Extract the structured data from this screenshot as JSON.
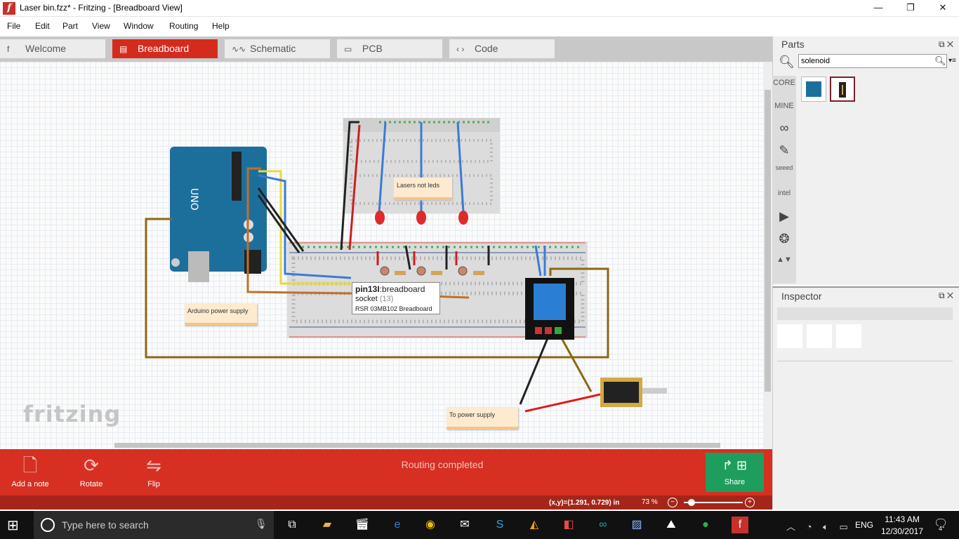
{
  "window": {
    "title": "Laser bin.fzz* - Fritzing - [Breadboard View]",
    "app_icon": "f",
    "minimize": "—",
    "maximize": "❐",
    "close": "✕"
  },
  "menubar": [
    "File",
    "Edit",
    "Part",
    "View",
    "Window",
    "Routing",
    "Help"
  ],
  "tabs": [
    {
      "label": "Welcome",
      "icon": "f",
      "active": false
    },
    {
      "label": "Breadboard",
      "icon": "▤",
      "active": true
    },
    {
      "label": "Schematic",
      "icon": "∿∿",
      "active": false
    },
    {
      "label": "PCB",
      "icon": "▭",
      "active": false
    },
    {
      "label": "Code",
      "icon": "‹ ›",
      "active": false
    }
  ],
  "canvas": {
    "notes": [
      "Lasers not leds",
      "Arduino power supply",
      "To power supply"
    ],
    "tooltip": {
      "line1_bold": "pin13I",
      "line1_rest": ":breadboard",
      "line2": "socket",
      "line2_extra": "(13)",
      "line3": "RSR 03MB102 Breadboard"
    },
    "watermark": "fritzing",
    "arduino_text": "UNO"
  },
  "toolbar": {
    "add_note": "Add a note",
    "rotate": "Rotate",
    "flip": "Flip",
    "status": "Routing completed",
    "share": "Share"
  },
  "statusbar": {
    "coords": "(x,y)=(1.291, 0.729) in",
    "zoom": "73 %",
    "zoom_fraction": 0.08
  },
  "parts": {
    "title": "Parts",
    "search_value": "solenoid",
    "bins": [
      "CORE",
      "MINE"
    ],
    "bin_icons": [
      "arduino-icon",
      "pen-icon",
      "seeed-icon",
      "intel-icon",
      "play-icon",
      "snowflake-icon",
      "grid-icon"
    ],
    "seeed_label": "seeed",
    "intel_label": "intel",
    "results": [
      "arduino-board-thumb",
      "solenoid-thumb"
    ]
  },
  "inspector": {
    "title": "Inspector"
  },
  "taskbar": {
    "search_placeholder": "Type here to search",
    "lang": "ENG",
    "time": "11:43 AM",
    "date": "12/30/2017",
    "notification_count": "4"
  },
  "colors": {
    "accent": "#d52b1e",
    "share": "#1e9e5c",
    "statusbar": "#a52619"
  }
}
